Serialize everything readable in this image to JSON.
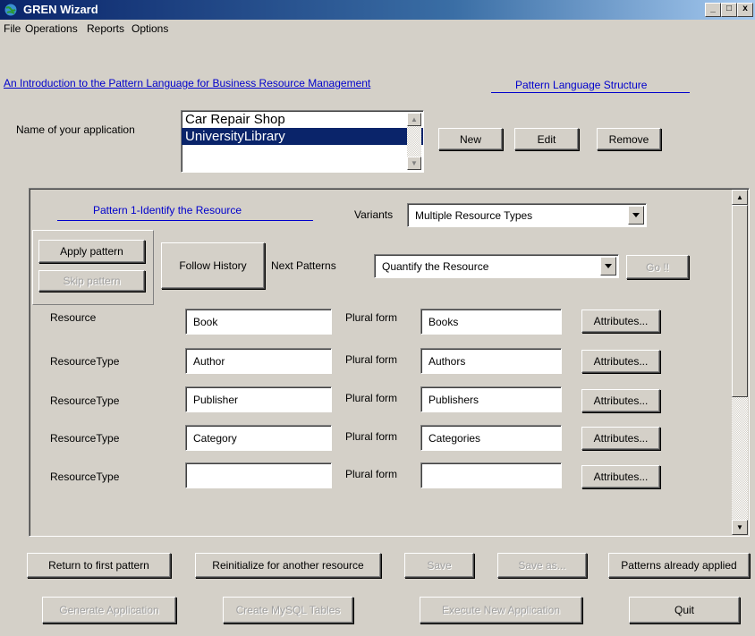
{
  "window": {
    "title": "GREN Wizard",
    "minimize": "_",
    "maximize": "□",
    "close": "x"
  },
  "menu": [
    "File",
    "Operations",
    "Reports",
    "Options"
  ],
  "links": {
    "intro": "An Introduction to the Pattern Language for Business Resource Management",
    "structure": "Pattern Language Structure"
  },
  "application": {
    "label": "Name of your application",
    "items": [
      "Car Repair Shop",
      "UniversityLibrary"
    ],
    "selected_index": 1,
    "new": "New",
    "edit": "Edit",
    "remove": "Remove"
  },
  "pattern": {
    "title": "Pattern 1-Identify the Resource",
    "variants_label": "Variants",
    "variant_value": "Multiple Resource Types",
    "apply": "Apply pattern",
    "skip": "Skip pattern",
    "follow_history": "Follow History",
    "next_patterns_label": "Next Patterns",
    "next_pattern_value": "Quantify the Resource",
    "go": "Go !!"
  },
  "rows": [
    {
      "label": "Resource",
      "value": "Book",
      "plural_label": "Plural form",
      "plural": "Books",
      "attributes": "Attributes..."
    },
    {
      "label": "ResourceType",
      "value": "Author",
      "plural_label": "Plural form",
      "plural": "Authors",
      "attributes": "Attributes..."
    },
    {
      "label": "ResourceType",
      "value": "Publisher",
      "plural_label": "Plural form",
      "plural": "Publishers",
      "attributes": "Attributes..."
    },
    {
      "label": "ResourceType",
      "value": "Category",
      "plural_label": "Plural form",
      "plural": "Categories",
      "attributes": "Attributes..."
    },
    {
      "label": "ResourceType",
      "value": "",
      "plural_label": "Plural form",
      "plural": "",
      "attributes": "Attributes..."
    }
  ],
  "bottom": {
    "return_first": "Return to first pattern",
    "reinitialize": "Reinitialize for another resource",
    "save": "Save",
    "save_as": "Save as...",
    "already_applied": "Patterns already applied",
    "generate": "Generate Application",
    "create_tables": "Create MySQL Tables",
    "execute": "Execute New Application",
    "quit": "Quit"
  }
}
